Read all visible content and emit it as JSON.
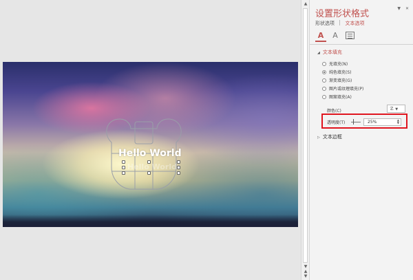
{
  "slide": {
    "hello_text": "Hello World",
    "hello_ghost_text": "Hello World"
  },
  "panel": {
    "title": "设置形状格式",
    "tabs": [
      {
        "label": "形状选项",
        "active": false
      },
      {
        "label": "文本选项",
        "active": true
      }
    ],
    "icons": [
      "text-fill-outline-icon",
      "text-effects-icon",
      "textbox-icon"
    ],
    "section_text_fill": "文本填充",
    "fill_options": [
      {
        "label": "无填充(N)",
        "selected": false
      },
      {
        "label": "纯色填充(S)",
        "selected": true
      },
      {
        "label": "渐变填充(G)",
        "selected": false
      },
      {
        "label": "图片或纹理填充(P)",
        "selected": false
      },
      {
        "label": "图案填充(A)",
        "selected": false
      }
    ],
    "color_label": "颜色(C)",
    "transparency_label": "透明度(T)",
    "transparency_value": "25%",
    "section_text_outline": "文本边框"
  },
  "colors": {
    "accent": "#c0504d",
    "highlight": "#e0141e"
  }
}
